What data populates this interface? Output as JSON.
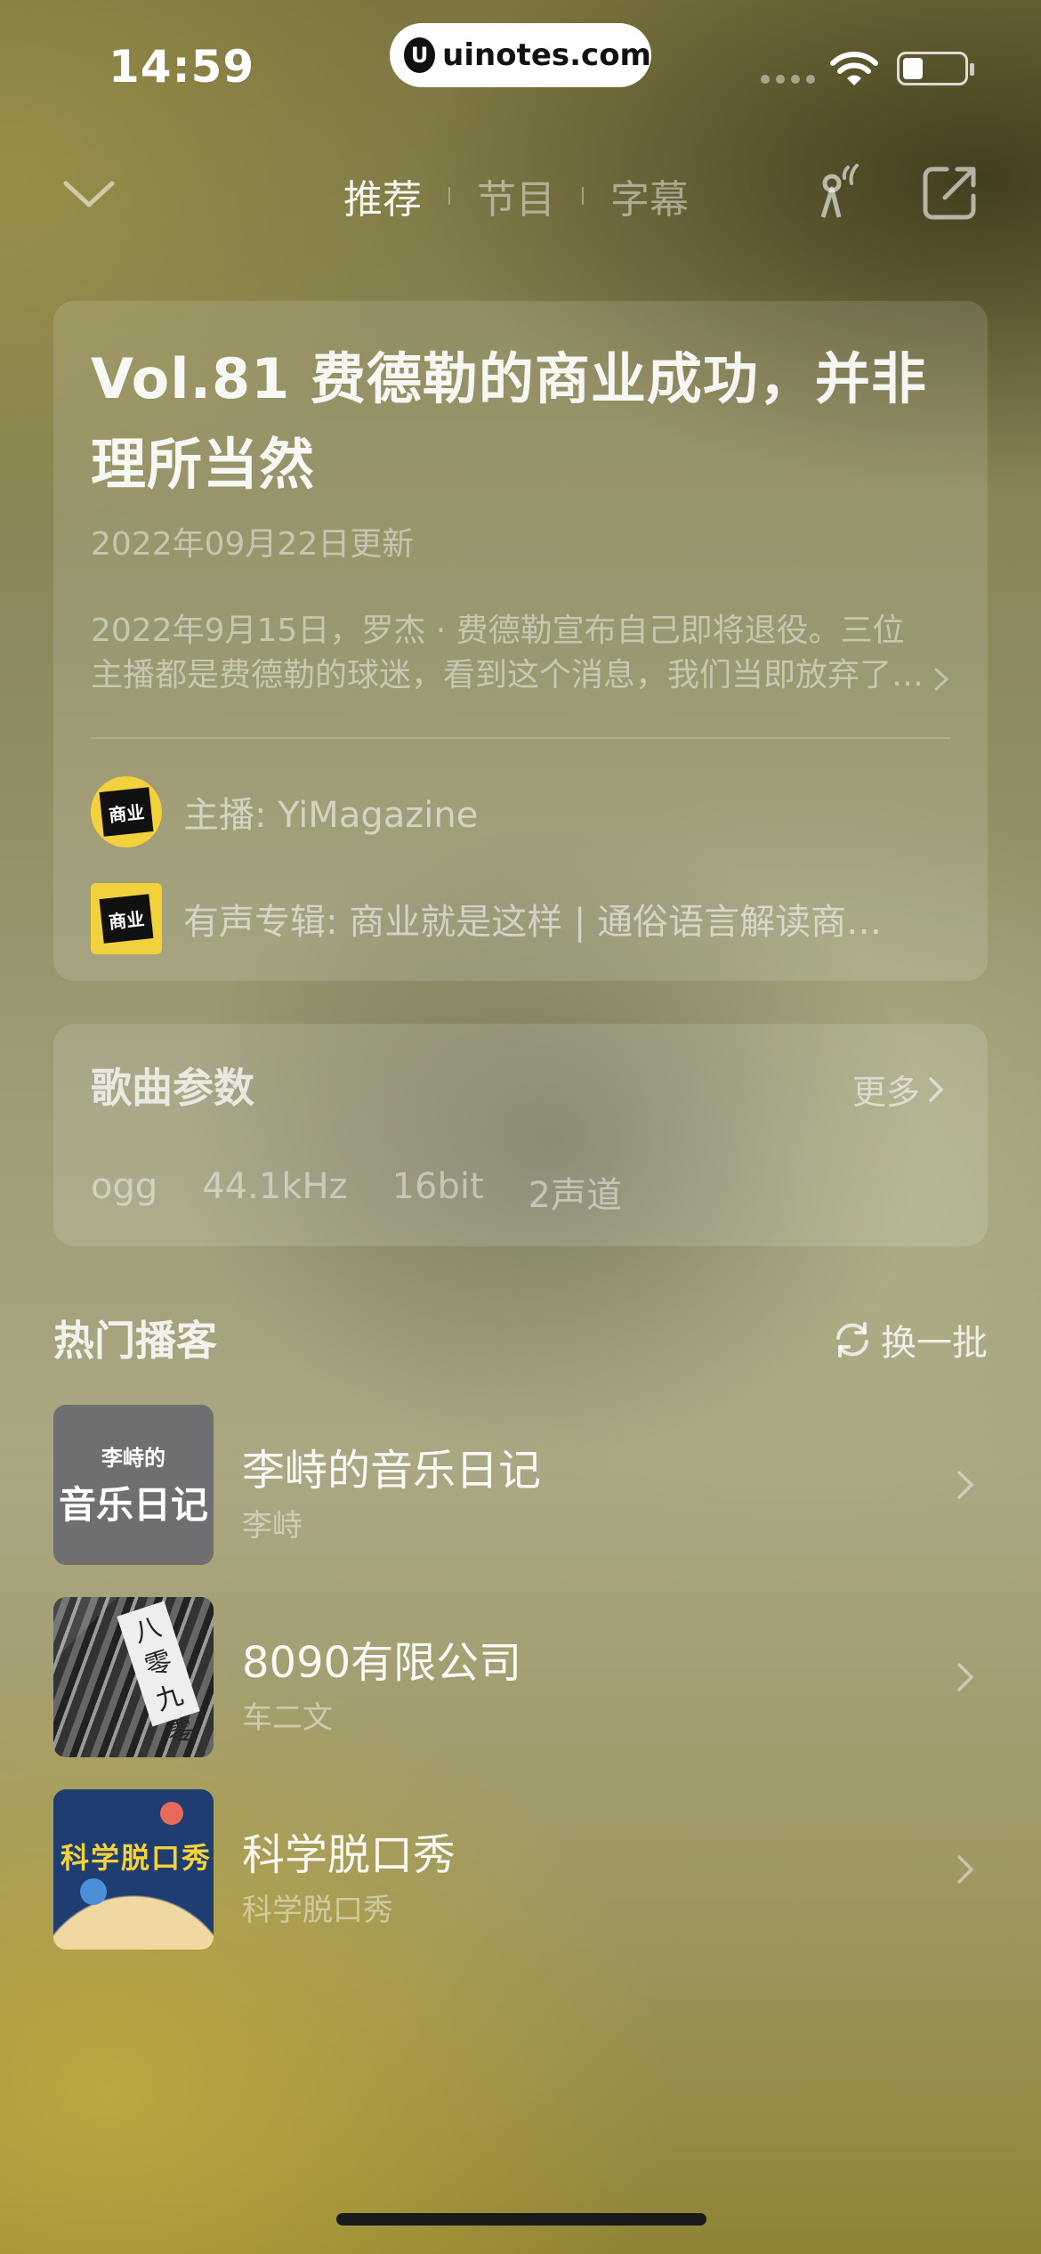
{
  "status_bar": {
    "time": "14:59",
    "watermark": "uinotes.com"
  },
  "nav": {
    "tabs": [
      {
        "label": "推荐",
        "active": true
      },
      {
        "label": "节目",
        "active": false
      },
      {
        "label": "字幕",
        "active": false
      }
    ]
  },
  "episode": {
    "title": "Vol.81 费德勒的商业成功，并非理所当然",
    "date": "2022年09月22日更新",
    "description": "2022年9月15日，罗杰 · 费德勒宣布自己即将退役。三位主播都是费德勒的球迷，看到这个消息，我们当即放弃了…",
    "host_label": "主播: YiMagazine",
    "album_label": "有声专辑: 商业就是这样 | 通俗语言解读商…",
    "avatar_text": "商业"
  },
  "params": {
    "title": "歌曲参数",
    "more_label": "更多",
    "values": [
      "ogg",
      "44.1kHz",
      "16bit",
      "2声道"
    ]
  },
  "hot": {
    "title": "热门播客",
    "refresh_label": "换一批",
    "items": [
      {
        "title": "李峙的音乐日记",
        "subtitle": "李峙",
        "cover_small": "李峙的",
        "cover_big": "音乐日记"
      },
      {
        "title": "8090有限公司",
        "subtitle": "车二文",
        "cover_sign": "八零九零"
      },
      {
        "title": "科学脱口秀",
        "subtitle": "科学脱口秀",
        "cover_text": "科学脱口秀"
      }
    ]
  },
  "colors": {
    "background_top": "#7d7640",
    "background_bottom": "#8f8434",
    "card": "rgba(255,255,255,0.13)",
    "avatar_yellow": "#f2d13c"
  }
}
